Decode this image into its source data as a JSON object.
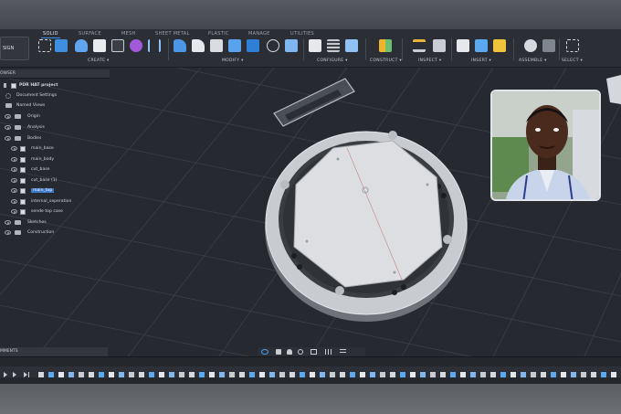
{
  "workspace": {
    "design_label": "SIGN"
  },
  "tabs": [
    {
      "label": "SOLID",
      "active": true
    },
    {
      "label": "SURFACE",
      "active": false
    },
    {
      "label": "MESH",
      "active": false
    },
    {
      "label": "SHEET METAL",
      "active": false
    },
    {
      "label": "PLASTIC",
      "active": false
    },
    {
      "label": "MANAGE",
      "active": false
    },
    {
      "label": "UTILITIES",
      "active": false
    }
  ],
  "groups": [
    {
      "label": "CREATE ▾"
    },
    {
      "label": "MODIFY ▾"
    },
    {
      "label": "CONFIGURE ▾"
    },
    {
      "label": "CONSTRUCT ▾"
    },
    {
      "label": "INSPECT ▾"
    },
    {
      "label": "INSERT ▾"
    },
    {
      "label": "ASSEMBLE ▾"
    },
    {
      "label": "SELECT ▾"
    }
  ],
  "browser": {
    "title": "OWSER",
    "project": "PDR HAT project",
    "items": [
      {
        "label": "Document Settings",
        "kind": "gear"
      },
      {
        "label": "Named Views",
        "kind": "folder"
      },
      {
        "label": "Origin",
        "kind": "folder"
      },
      {
        "label": "Analysis",
        "kind": "folder"
      },
      {
        "label": "Bodies",
        "kind": "folder"
      },
      {
        "label": "main_base",
        "kind": "body"
      },
      {
        "label": "main_body",
        "kind": "body"
      },
      {
        "label": "cut_base",
        "kind": "body"
      },
      {
        "label": "cut_base (1)",
        "kind": "body"
      },
      {
        "label": "main_top",
        "kind": "body",
        "selected": true
      },
      {
        "label": "internal_seperation",
        "kind": "body"
      },
      {
        "label": "sende top case",
        "kind": "body"
      },
      {
        "label": "Sketches",
        "kind": "folder"
      },
      {
        "label": "Construction",
        "kind": "folder"
      }
    ]
  },
  "comments": {
    "label": "MMENTS"
  },
  "colors": {
    "accent": "#3a8de8",
    "selection": "#3c78c8",
    "toolbar": "#2b2f35",
    "viewport": "#262a30"
  }
}
